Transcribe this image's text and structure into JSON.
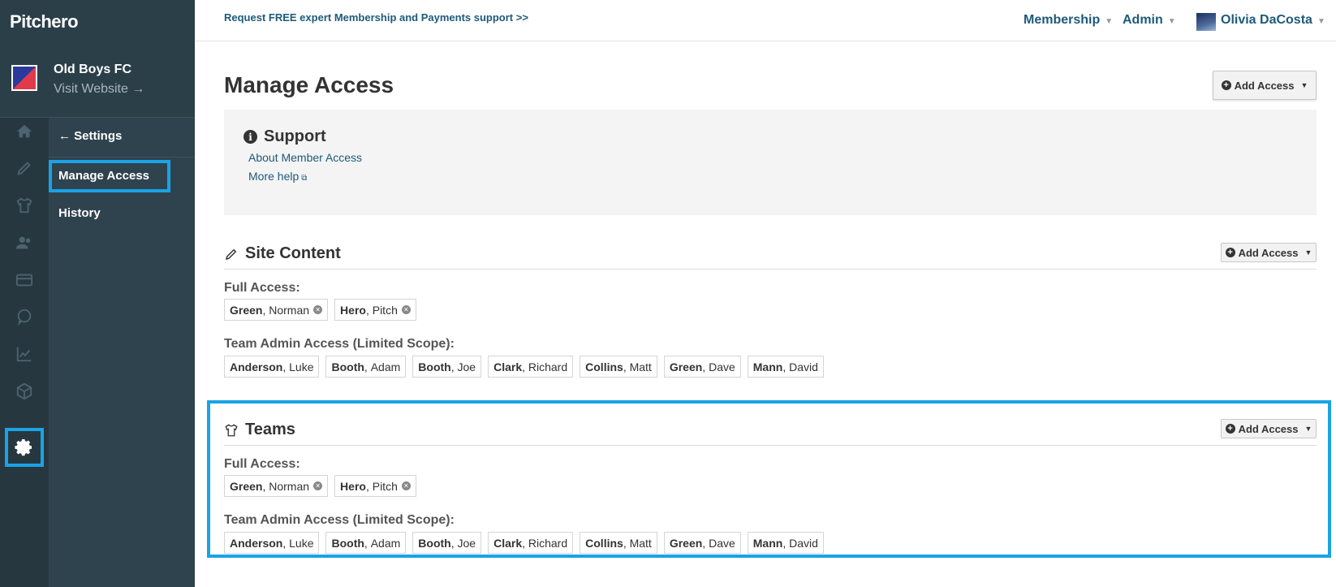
{
  "brand": {
    "logo_text": "Pitchero"
  },
  "club": {
    "name": "Old Boys FC",
    "visit_label": "Visit Website →"
  },
  "subnav": {
    "back_label": "← Settings",
    "items": [
      {
        "label": "Manage Access",
        "active": true
      },
      {
        "label": "History",
        "active": false
      }
    ]
  },
  "rail": {
    "icons": [
      "home-icon",
      "pencil-icon",
      "shirt-icon",
      "users-icon",
      "card-icon",
      "chat-icon",
      "chart-icon",
      "box-icon",
      "gear-icon"
    ],
    "active_icon": "gear-icon"
  },
  "topbar": {
    "support_link": "Request FREE expert Membership and Payments support >>",
    "nav": [
      {
        "label": "Membership"
      },
      {
        "label": "Admin"
      },
      {
        "label": "Olivia DaCosta"
      }
    ]
  },
  "page": {
    "title": "Manage Access",
    "add_access_label": "Add Access"
  },
  "support": {
    "title": "Support",
    "links": [
      {
        "label": "About Member Access"
      },
      {
        "label": "More help"
      }
    ]
  },
  "sections": [
    {
      "title": "Site Content",
      "icon": "pencil-icon",
      "add_access_label": "Add Access",
      "full_access_label": "Full Access:",
      "full_access": [
        {
          "last": "Green",
          "first": "Norman"
        },
        {
          "last": "Hero",
          "first": "Pitch"
        }
      ],
      "limited_label": "Team Admin Access (Limited Scope):",
      "limited": [
        {
          "last": "Anderson",
          "first": "Luke"
        },
        {
          "last": "Booth",
          "first": "Adam"
        },
        {
          "last": "Booth",
          "first": "Joe"
        },
        {
          "last": "Clark",
          "first": "Richard"
        },
        {
          "last": "Collins",
          "first": "Matt"
        },
        {
          "last": "Green",
          "first": "Dave"
        },
        {
          "last": "Mann",
          "first": "David"
        }
      ]
    },
    {
      "title": "Teams",
      "icon": "shirt-icon",
      "add_access_label": "Add Access",
      "full_access_label": "Full Access:",
      "full_access": [
        {
          "last": "Green",
          "first": "Norman"
        },
        {
          "last": "Hero",
          "first": "Pitch"
        }
      ],
      "limited_label": "Team Admin Access (Limited Scope):",
      "limited": [
        {
          "last": "Anderson",
          "first": "Luke"
        },
        {
          "last": "Booth",
          "first": "Adam"
        },
        {
          "last": "Booth",
          "first": "Joe"
        },
        {
          "last": "Clark",
          "first": "Richard"
        },
        {
          "last": "Collins",
          "first": "Matt"
        },
        {
          "last": "Green",
          "first": "Dave"
        },
        {
          "last": "Mann",
          "first": "David"
        }
      ]
    }
  ],
  "colors": {
    "sidebar": "#2b3f49",
    "accent_highlight": "#1aa3e6",
    "link": "#1e5a7a"
  }
}
